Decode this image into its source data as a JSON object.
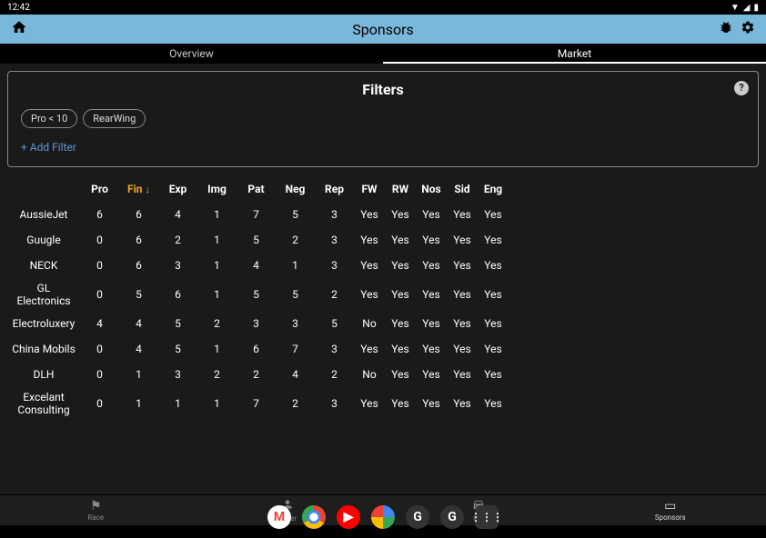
{
  "status": {
    "time": "12:42",
    "wifi": "▾▴",
    "battery": "▮"
  },
  "appbar": {
    "title": "Sponsors"
  },
  "tabs": {
    "overview": "Overview",
    "market": "Market"
  },
  "filters": {
    "title": "Filters",
    "chips": [
      "Pro < 10",
      "RearWing"
    ],
    "add": "+ Add Filter",
    "help": "?"
  },
  "table": {
    "headers": [
      "Pro",
      "Fin",
      "Exp",
      "Img",
      "Pat",
      "Neg",
      "Rep",
      "FW",
      "RW",
      "Nos",
      "Sid",
      "Eng"
    ],
    "sort_col": 1,
    "rows": [
      {
        "name": "AussieJet",
        "vals": [
          "6",
          "6",
          "4",
          "1",
          "7",
          "5",
          "3",
          "Yes",
          "Yes",
          "Yes",
          "Yes",
          "Yes"
        ]
      },
      {
        "name": "Guugle",
        "vals": [
          "0",
          "6",
          "2",
          "1",
          "5",
          "2",
          "3",
          "Yes",
          "Yes",
          "Yes",
          "Yes",
          "Yes"
        ]
      },
      {
        "name": "NECK",
        "vals": [
          "0",
          "6",
          "3",
          "1",
          "4",
          "1",
          "3",
          "Yes",
          "Yes",
          "Yes",
          "Yes",
          "Yes"
        ]
      },
      {
        "name": "GL Electronics",
        "vals": [
          "0",
          "5",
          "6",
          "1",
          "5",
          "5",
          "2",
          "Yes",
          "Yes",
          "Yes",
          "Yes",
          "Yes"
        ]
      },
      {
        "name": "Electroluxery",
        "vals": [
          "4",
          "4",
          "5",
          "2",
          "3",
          "3",
          "5",
          "No",
          "Yes",
          "Yes",
          "Yes",
          "Yes"
        ]
      },
      {
        "name": "China Mobils",
        "vals": [
          "0",
          "4",
          "5",
          "1",
          "6",
          "7",
          "3",
          "Yes",
          "Yes",
          "Yes",
          "Yes",
          "Yes"
        ]
      },
      {
        "name": "DLH",
        "vals": [
          "0",
          "1",
          "3",
          "2",
          "2",
          "4",
          "2",
          "No",
          "Yes",
          "Yes",
          "Yes",
          "Yes"
        ]
      },
      {
        "name": "Excelant Consulting",
        "vals": [
          "0",
          "1",
          "1",
          "1",
          "7",
          "2",
          "3",
          "Yes",
          "Yes",
          "Yes",
          "Yes",
          "Yes"
        ]
      }
    ]
  },
  "nav": {
    "race": "Race",
    "driver": "Driver",
    "car": "Car",
    "sponsors": "Sponsors"
  },
  "dock": {
    "gmail": "M",
    "yt": "▶",
    "g1": "G",
    "g2": "G",
    "apps": "⋮⋮⋮"
  }
}
